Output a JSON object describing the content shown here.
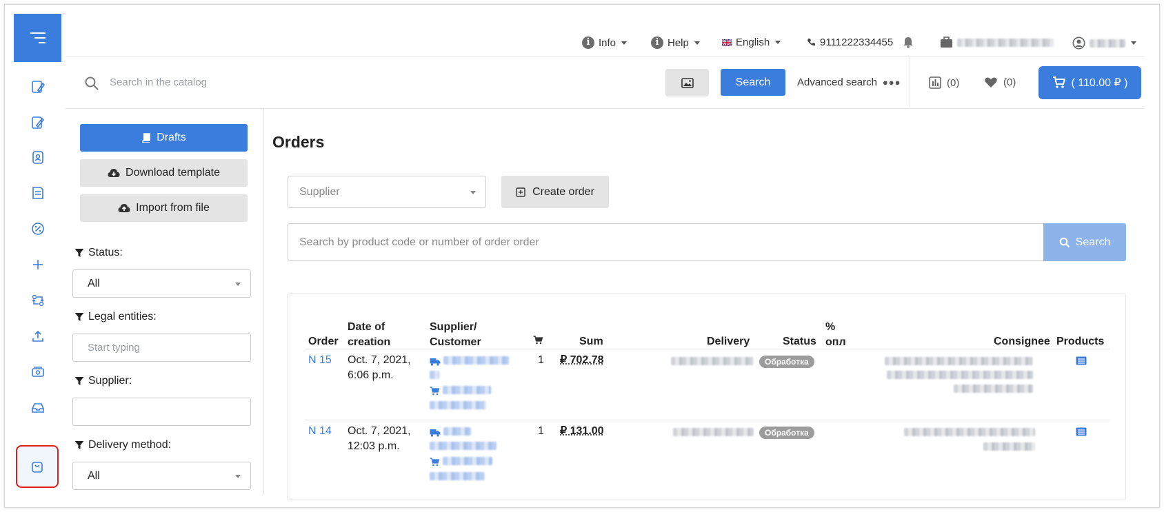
{
  "topbar": {
    "info_label": "Info",
    "help_label": "Help",
    "language_label": "English",
    "phone": "9111222334455"
  },
  "search": {
    "placeholder": "Search in the catalog",
    "button_label": "Search",
    "advanced_label": "Advanced search",
    "compare_count": "(0)",
    "favorites_count": "(0)",
    "cart_label": "( 110.00 ₽ )"
  },
  "sidebar": {
    "drafts_label": "Drafts",
    "download_template_label": "Download template",
    "import_label": "Import from file",
    "status_label": "Status:",
    "status_value": "All",
    "legal_entities_label": "Legal entities:",
    "legal_entities_placeholder": "Start typing",
    "supplier_label": "Supplier:",
    "delivery_method_label": "Delivery method:",
    "delivery_method_value": "All"
  },
  "main": {
    "title": "Orders",
    "supplier_placeholder": "Supplier",
    "create_order_label": "Create order",
    "order_search_placeholder": "Search by product code or number of order order",
    "order_search_button": "Search"
  },
  "table": {
    "headers": {
      "order": "Order",
      "date_1": "Date of",
      "date_2": "creation",
      "supplier_1": "Supplier/",
      "supplier_2": "Customer",
      "sum": "Sum",
      "delivery": "Delivery",
      "status": "Status",
      "paid_1": "%",
      "paid_2": "опл",
      "consignee": "Consignee",
      "products": "Products"
    },
    "rows": [
      {
        "order": "N 15",
        "date_1": "Oct. 7, 2021,",
        "date_2": "6:06 p.m.",
        "qty": "1",
        "sum": "₽ 702.78",
        "status": "Обработка"
      },
      {
        "order": "N 14",
        "date_1": "Oct. 7, 2021,",
        "date_2": "12:03 p.m.",
        "qty": "1",
        "sum": "₽ 131.00",
        "status": "Обработка"
      }
    ]
  },
  "colors": {
    "accent": "#3b7ddd",
    "highlight": "#e0201b",
    "badge": "#9c9c9c"
  }
}
